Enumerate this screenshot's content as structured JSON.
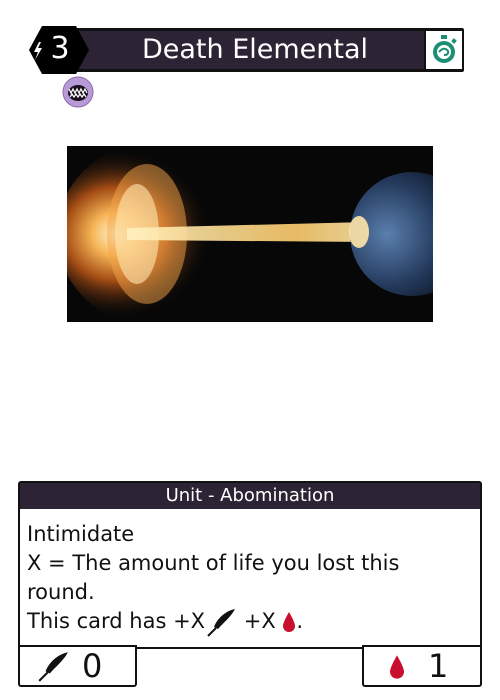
{
  "card": {
    "name": "Death Elemental",
    "cost": "3",
    "type_line": "Unit - Abomination",
    "rules": {
      "line1": "Intimidate",
      "line2": "X = The amount of life you lost this round.",
      "line3_prefix": "This card has +X",
      "line3_mid": " +X",
      "line3_suffix": "."
    },
    "attack": "0",
    "health": "1"
  },
  "icons": {
    "cost": "energy-bolt-icon",
    "speed": "stopwatch-icon",
    "faction": "maw-icon",
    "attack": "feather-sword-icon",
    "health": "blood-drop-icon"
  },
  "colors": {
    "frame": "#2c2434",
    "speed_icon": "#1a8f73",
    "faction_icon": "#b79ad6",
    "health": "#c8102e"
  }
}
